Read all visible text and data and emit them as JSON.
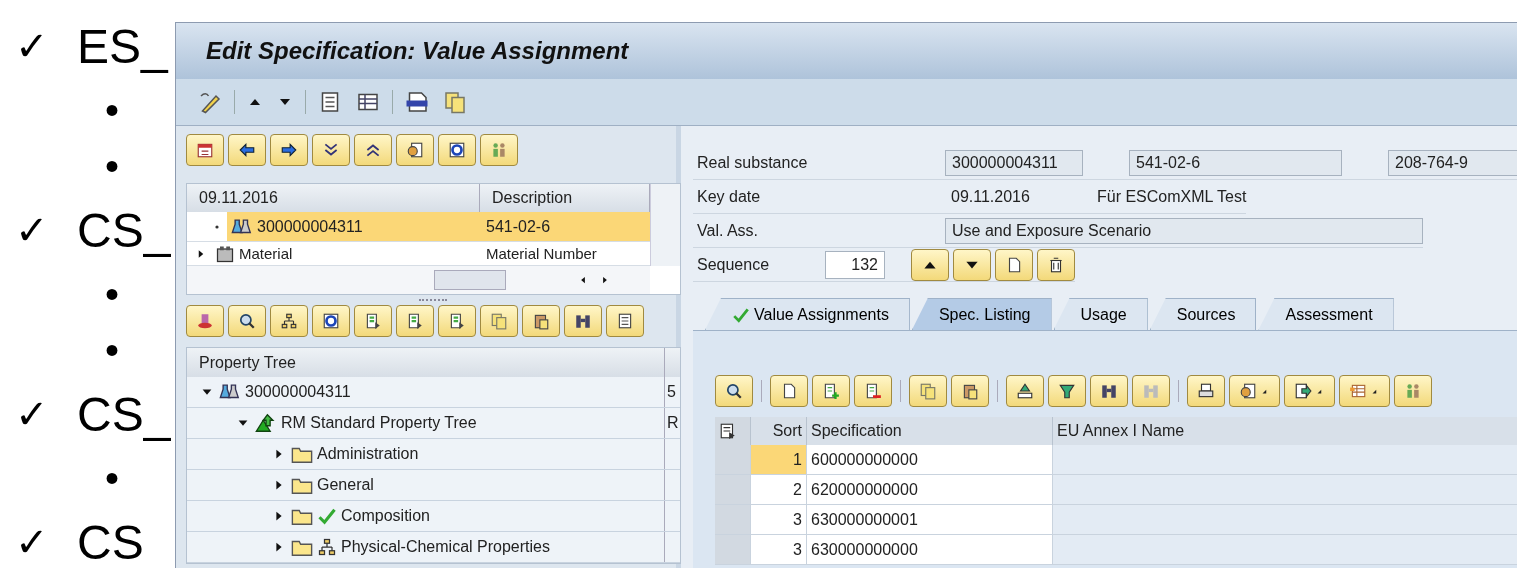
{
  "slide": {
    "items": [
      {
        "kind": "check",
        "marker": "✓",
        "text": "ES_"
      },
      {
        "kind": "bullet",
        "marker": "•"
      },
      {
        "kind": "bullet",
        "marker": "•"
      },
      {
        "kind": "check",
        "marker": "✓",
        "text": "CS_"
      },
      {
        "kind": "bullet",
        "marker": "•"
      },
      {
        "kind": "bullet",
        "marker": "•"
      },
      {
        "kind": "check",
        "marker": "✓",
        "text": "CS_"
      },
      {
        "kind": "bullet",
        "marker": "•"
      },
      {
        "kind": "check",
        "marker": "✓",
        "text": "CS"
      }
    ]
  },
  "window": {
    "title": "Edit Specification: Value Assignment"
  },
  "hit_list": {
    "columns": [
      "09.11.2016",
      "Description"
    ],
    "rows": [
      {
        "kind": "substance",
        "name": "300000004311",
        "description": "541-02-6",
        "selected": true
      },
      {
        "kind": "material",
        "name": "Material",
        "description": "Material Number",
        "expanded": false,
        "selected": false
      }
    ]
  },
  "property_tree": {
    "title": "Property Tree",
    "nodes": [
      {
        "kind": "substance",
        "label": "300000004311",
        "column_2": "5",
        "expanded": true,
        "children": [
          {
            "kind": "tree",
            "label": "RM Standard Property Tree",
            "column_2": "R",
            "expanded": true,
            "children": [
              {
                "kind": "folder",
                "label": "Administration",
                "expanded": false
              },
              {
                "kind": "folder",
                "label": "General",
                "expanded": false
              },
              {
                "kind": "folder-check",
                "label": "Composition",
                "expanded": false
              },
              {
                "kind": "folder-hierarchy",
                "label": "Physical-Chemical Properties",
                "expanded": false
              }
            ]
          }
        ]
      }
    ]
  },
  "header": {
    "real_substance": {
      "label": "Real substance",
      "values": [
        "300000004311",
        "541-02-6",
        "208-764-9"
      ]
    },
    "key_date": {
      "label": "Key date",
      "date": "09.11.2016",
      "text": "Für ESComXML Test"
    },
    "val_ass": {
      "label": "Val. Ass.",
      "value": "Use and Exposure Scenario"
    },
    "sequence": {
      "label": "Sequence",
      "value": "132"
    }
  },
  "tabs": [
    {
      "label": "Value Assignments",
      "checked": true,
      "selected": false
    },
    {
      "label": "Spec. Listing",
      "checked": false,
      "selected": true
    },
    {
      "label": "Usage",
      "checked": false,
      "selected": false
    },
    {
      "label": "Sources",
      "checked": false,
      "selected": false
    },
    {
      "label": "Assessment",
      "checked": false,
      "selected": false
    }
  ],
  "grid": {
    "columns": [
      "Sort",
      "Specification",
      "EU Annex I Name"
    ],
    "rows": [
      {
        "sort": "1",
        "specification": "600000000000",
        "selected": true
      },
      {
        "sort": "2",
        "specification": "620000000000",
        "selected": false
      },
      {
        "sort": "3",
        "specification": "630000000001",
        "selected": false
      },
      {
        "sort": "3",
        "specification": "630000000000",
        "selected": false
      }
    ]
  }
}
